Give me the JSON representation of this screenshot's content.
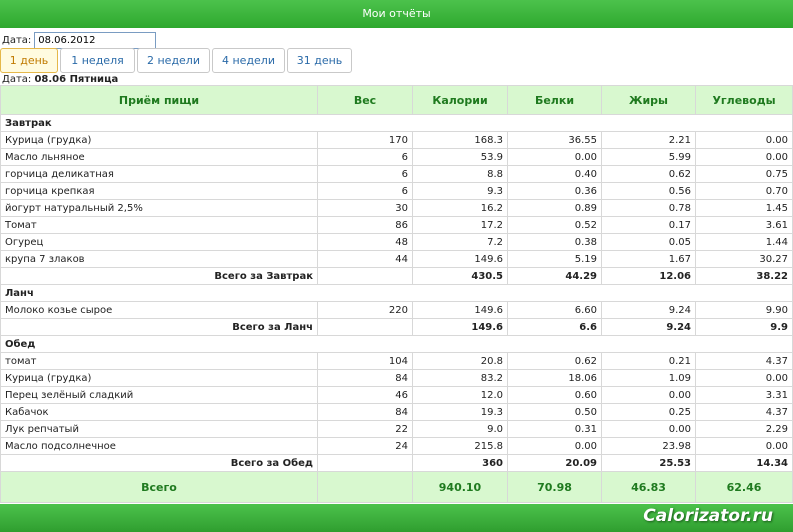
{
  "title": "Мои отчёты",
  "date_label": "Дата:",
  "date_value": "08.06.2012",
  "tabs": [
    "1 день",
    "1 неделя",
    "2 недели",
    "4 недели",
    "31 день"
  ],
  "day_prefix": "Дата:",
  "day_value": "08.06 Пятница",
  "columns": [
    "Приём пищи",
    "Вес",
    "Калории",
    "Белки",
    "Жиры",
    "Углеводы"
  ],
  "meals": [
    {
      "name": "Завтрак",
      "items": [
        [
          "Курица (грудка)",
          "170",
          "168.3",
          "36.55",
          "2.21",
          "0.00"
        ],
        [
          "Масло льняное",
          "6",
          "53.9",
          "0.00",
          "5.99",
          "0.00"
        ],
        [
          "горчица деликатная",
          "6",
          "8.8",
          "0.40",
          "0.62",
          "0.75"
        ],
        [
          "горчица крепкая",
          "6",
          "9.3",
          "0.36",
          "0.56",
          "0.70"
        ],
        [
          "йогурт натуральный 2,5%",
          "30",
          "16.2",
          "0.89",
          "0.78",
          "1.45"
        ],
        [
          "Томат",
          "86",
          "17.2",
          "0.52",
          "0.17",
          "3.61"
        ],
        [
          "Огурец",
          "48",
          "7.2",
          "0.38",
          "0.05",
          "1.44"
        ],
        [
          "крупа 7 злаков",
          "44",
          "149.6",
          "5.19",
          "1.67",
          "30.27"
        ]
      ],
      "total_label": "Всего за Завтрак",
      "total": [
        "430.5",
        "44.29",
        "12.06",
        "38.22"
      ]
    },
    {
      "name": "Ланч",
      "items": [
        [
          "Молоко козье сырое",
          "220",
          "149.6",
          "6.60",
          "9.24",
          "9.90"
        ]
      ],
      "total_label": "Всего за Ланч",
      "total": [
        "149.6",
        "6.6",
        "9.24",
        "9.9"
      ]
    },
    {
      "name": "Обед",
      "items": [
        [
          "томат",
          "104",
          "20.8",
          "0.62",
          "0.21",
          "4.37"
        ],
        [
          "Курица (грудка)",
          "84",
          "83.2",
          "18.06",
          "1.09",
          "0.00"
        ],
        [
          "Перец зелёный сладкий",
          "46",
          "12.0",
          "0.60",
          "0.00",
          "3.31"
        ],
        [
          "Кабачок",
          "84",
          "19.3",
          "0.50",
          "0.25",
          "4.37"
        ],
        [
          "Лук репчатый",
          "22",
          "9.0",
          "0.31",
          "0.00",
          "2.29"
        ],
        [
          "Масло подсолнечное",
          "24",
          "215.8",
          "0.00",
          "23.98",
          "0.00"
        ]
      ],
      "total_label": "Всего за Обед",
      "total": [
        "360",
        "20.09",
        "25.53",
        "14.34"
      ]
    }
  ],
  "grand_label": "Всего",
  "grand_total": [
    "940.10",
    "70.98",
    "46.83",
    "62.46"
  ],
  "brand": "Calorizator.ru"
}
